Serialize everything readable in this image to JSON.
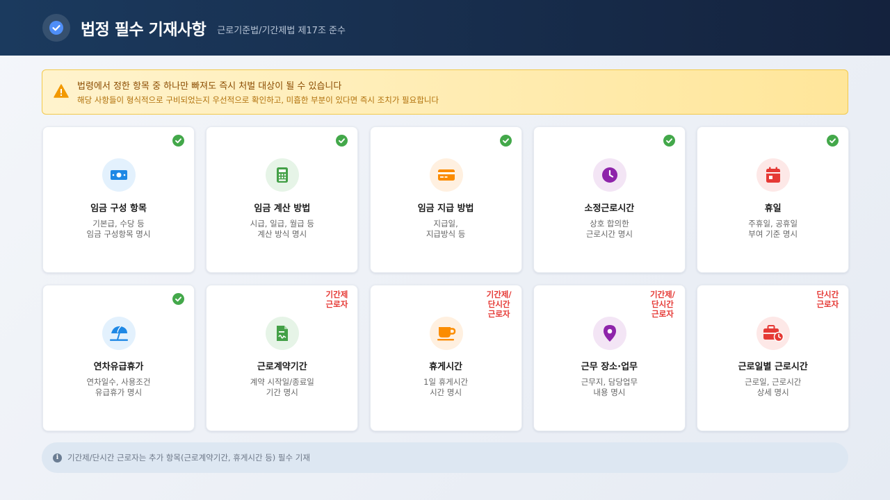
{
  "header": {
    "title": "법정 필수 기재사항",
    "subtitle": "근로기준법/기간제법 제17조 준수",
    "badge_icon": "check-circle-icon"
  },
  "alert": {
    "title": "법령에서 정한 항목 중 하나만 빠져도 즉시 처벌 대상이 될 수 있습니다",
    "description": "해당 사항들이 형식적으로 구비되었는지 우선적으로 확인하고, 미흡한 부분이 있다면 즉시 조치가 필요합니다",
    "icon": "warning-icon"
  },
  "cards": [
    {
      "title": "임금 구성 항목",
      "desc": "기본급, 수당 등\n임금 구성항목 명시",
      "icon": "money-icon",
      "color": "#1e88e5",
      "bg": "#e3f1fd",
      "status": "check",
      "tag": ""
    },
    {
      "title": "임금 계산 방법",
      "desc": "시급, 일급, 월급 등\n계산 방식 명시",
      "icon": "calculator-icon",
      "color": "#43a047",
      "bg": "#e6f4e7",
      "status": "check",
      "tag": ""
    },
    {
      "title": "임금 지급 방법",
      "desc": "지급일,\n지급방식 등",
      "icon": "credit-card-icon",
      "color": "#fb8c00",
      "bg": "#fff0e0",
      "status": "check",
      "tag": ""
    },
    {
      "title": "소정근로시간",
      "desc": "상호 합의한\n근로시간 명시",
      "icon": "clock-icon",
      "color": "#8e24aa",
      "bg": "#f3e5f5",
      "status": "check",
      "tag": ""
    },
    {
      "title": "휴일",
      "desc": "주휴일, 공휴일\n부여 기준 명시",
      "icon": "calendar-icon",
      "color": "#e53935",
      "bg": "#fde8e7",
      "status": "check",
      "tag": ""
    },
    {
      "title": "연차유급휴가",
      "desc": "연차일수, 사용조건\n유급휴가 명시",
      "icon": "beach-umbrella-icon",
      "color": "#1e88e5",
      "bg": "#e3f1fd",
      "status": "check",
      "tag": ""
    },
    {
      "title": "근로계약기간",
      "desc": "계약 시작일/종료일\n기간 명시",
      "icon": "contract-icon",
      "color": "#43a047",
      "bg": "#e6f4e7",
      "status": "tag",
      "tag": "기간제\n근로자"
    },
    {
      "title": "휴게시간",
      "desc": "1일 휴게시간\n시간 명시",
      "icon": "coffee-icon",
      "color": "#fb8c00",
      "bg": "#fff0e0",
      "status": "tag",
      "tag": "기간제/\n단시간\n근로자"
    },
    {
      "title": "근무 장소·업무",
      "desc": "근무지, 담당업무\n내용 명시",
      "icon": "location-pin-icon",
      "color": "#8e24aa",
      "bg": "#f3e5f5",
      "status": "tag",
      "tag": "기간제/\n단시간\n근로자"
    },
    {
      "title": "근로일별 근로시간",
      "desc": "근로일, 근로시간\n상세 명시",
      "icon": "briefcase-clock-icon",
      "color": "#e53935",
      "bg": "#fde8e7",
      "status": "tag",
      "tag": "단시간\n근로자"
    }
  ],
  "footer": {
    "text": "기간제/단시간 근로자는 추가 항목(근로계약기간, 휴게시간 등) 필수 기재",
    "icon": "info-icon"
  }
}
